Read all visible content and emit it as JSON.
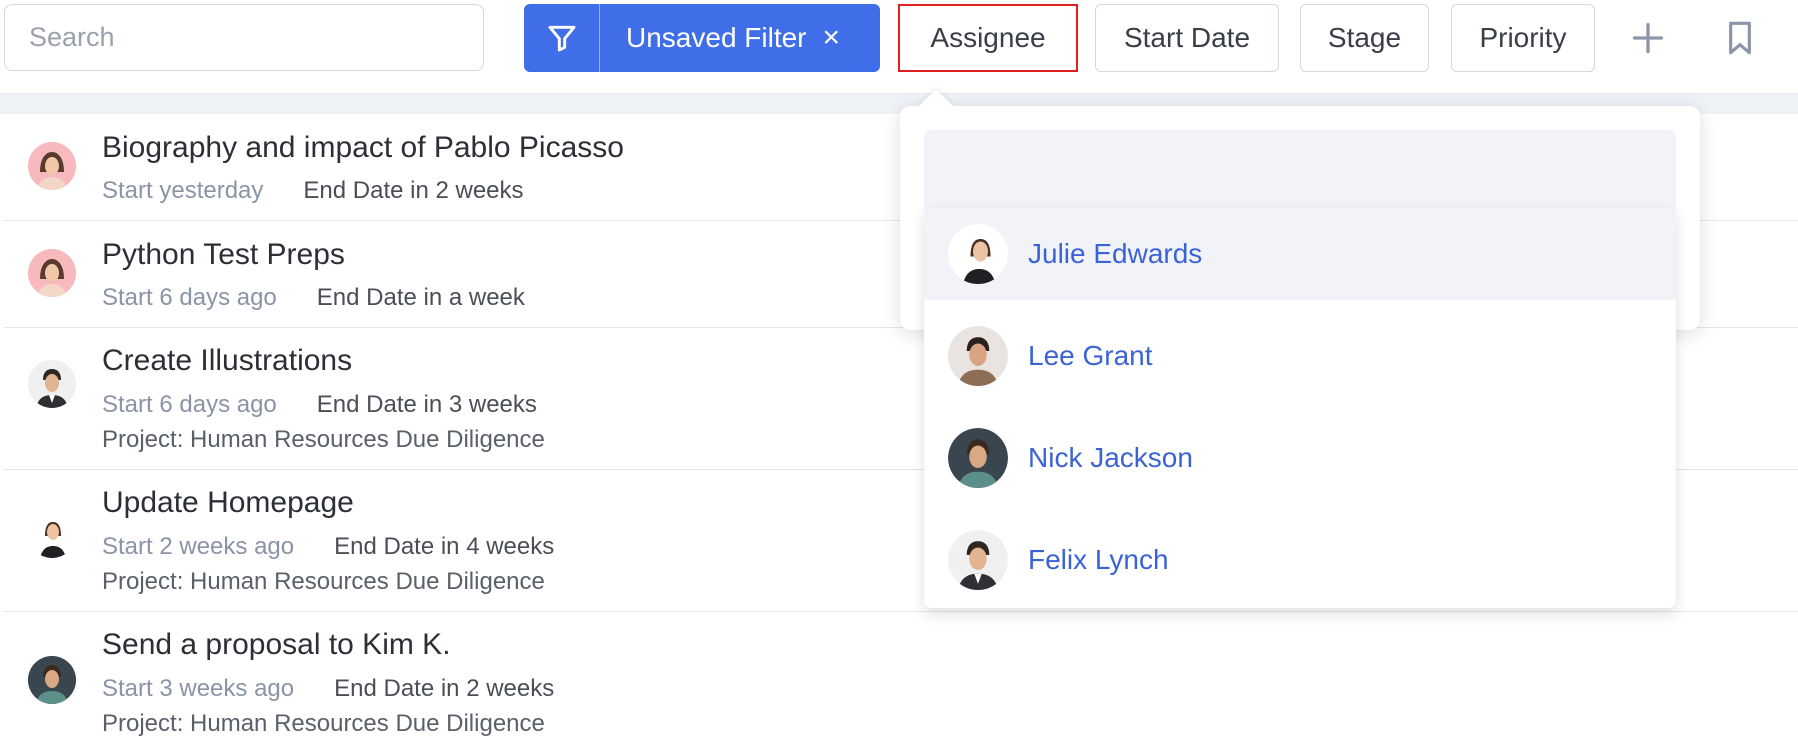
{
  "search": {
    "placeholder": "Search",
    "value": ""
  },
  "filter": {
    "label": "Unsaved Filter",
    "close_glyph": "×",
    "icon": "filter-icon",
    "color": "#3f6ee8"
  },
  "chips": [
    "Assignee",
    "Start Date",
    "Stage",
    "Priority"
  ],
  "active_chip": "Assignee",
  "toolbar_icons": [
    "plus-icon",
    "bookmark-icon"
  ],
  "tasks": [
    {
      "title": "Biography and impact of Pablo Picasso",
      "start": "Start yesterday",
      "end": "End Date in 2 weeks",
      "project": ""
    },
    {
      "title": "Python Test Preps",
      "start": "Start 6 days ago",
      "end": "End Date in a week",
      "project": ""
    },
    {
      "title": "Create Illustrations",
      "start": "Start 6 days ago",
      "end": "End Date in 3 weeks",
      "project": "Project: Human Resources Due Diligence"
    },
    {
      "title": "Update Homepage",
      "start": "Start 2 weeks ago",
      "end": "End Date in 4 weeks",
      "project": "Project: Human Resources Due Diligence"
    },
    {
      "title": "Send a proposal to Kim K.",
      "start": "Start 3 weeks ago",
      "end": "End Date in 2 weeks",
      "project": "Project: Human Resources Due Diligence"
    }
  ],
  "assignee_dropdown": {
    "search_value": "",
    "highlighted": "Julie Edwards",
    "options": [
      "Julie Edwards",
      "Lee Grant",
      "Nick Jackson",
      "Felix Lynch"
    ]
  },
  "colors": {
    "accent": "#3f6ee8",
    "link": "#3b63d6",
    "active_outline": "#e02020",
    "muted": "#8a94a6"
  }
}
